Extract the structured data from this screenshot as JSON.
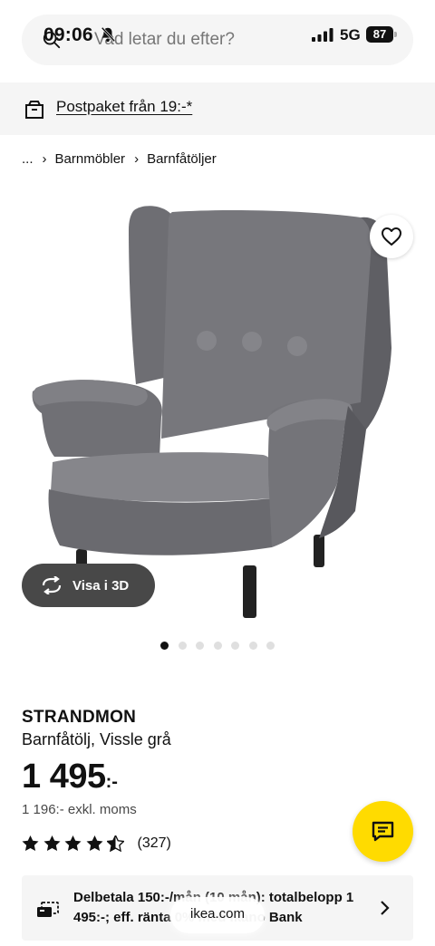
{
  "status_bar": {
    "time": "09:06",
    "network": "5G",
    "battery": "87"
  },
  "search": {
    "placeholder": "Vad letar du efter?"
  },
  "shipping_banner": {
    "text": "Postpaket från 19:-*"
  },
  "breadcrumb": {
    "ellipsis": "...",
    "items": [
      "Barnmöbler",
      "Barnfåtöljer"
    ]
  },
  "gallery": {
    "view_3d_label": "Visa i 3D",
    "image_count": 7,
    "active_index": 0
  },
  "product": {
    "name": "STRANDMON",
    "description": "Barnfåtölj, Vissle grå",
    "price": "1 495",
    "price_suffix": ":-",
    "price_excl_vat": "1 196:- exkl. moms",
    "rating": 4.5,
    "review_count": "(327)"
  },
  "financing": {
    "text": "Delbetala 150:-/mån (10 mån): totalbelopp 1 495:-; eff. ränta 0% med Ikano Bank"
  },
  "browser": {
    "url": "ikea.com"
  },
  "colors": {
    "chat_button": "#ffdb00",
    "banner_bg": "#f5f5f5",
    "view_3d_bg": "#484848"
  }
}
